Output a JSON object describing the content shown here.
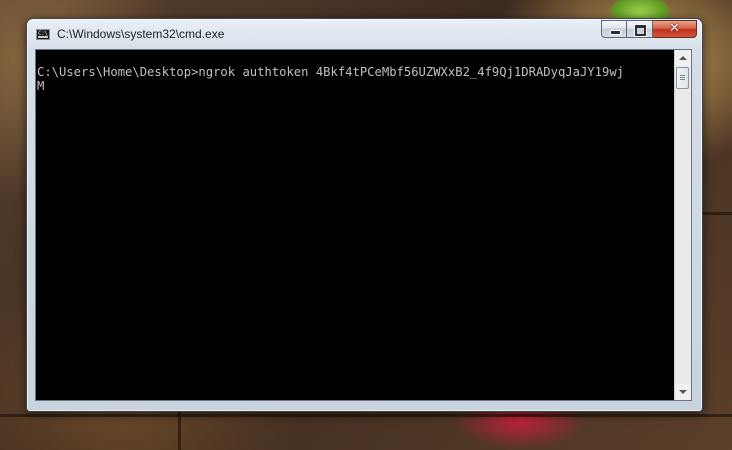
{
  "window": {
    "title": "C:\\Windows\\system32\\cmd.exe",
    "icon": "command-prompt-icon"
  },
  "caption_buttons": {
    "minimize_icon": "minimize-icon",
    "maximize_icon": "maximize-icon",
    "close_label": "✕"
  },
  "console": {
    "lines": [
      "C:\\Users\\Home\\Desktop>ngrok authtoken 4Bkf4tPCeMbf56UZWXxB2_4f9Qj1DRADyqJaJY19wj",
      "M"
    ],
    "background": "#000000",
    "foreground": "#c0c0c0"
  },
  "scrollbar": {
    "up_icon": "scroll-up-arrow-icon",
    "down_icon": "scroll-down-arrow-icon"
  }
}
